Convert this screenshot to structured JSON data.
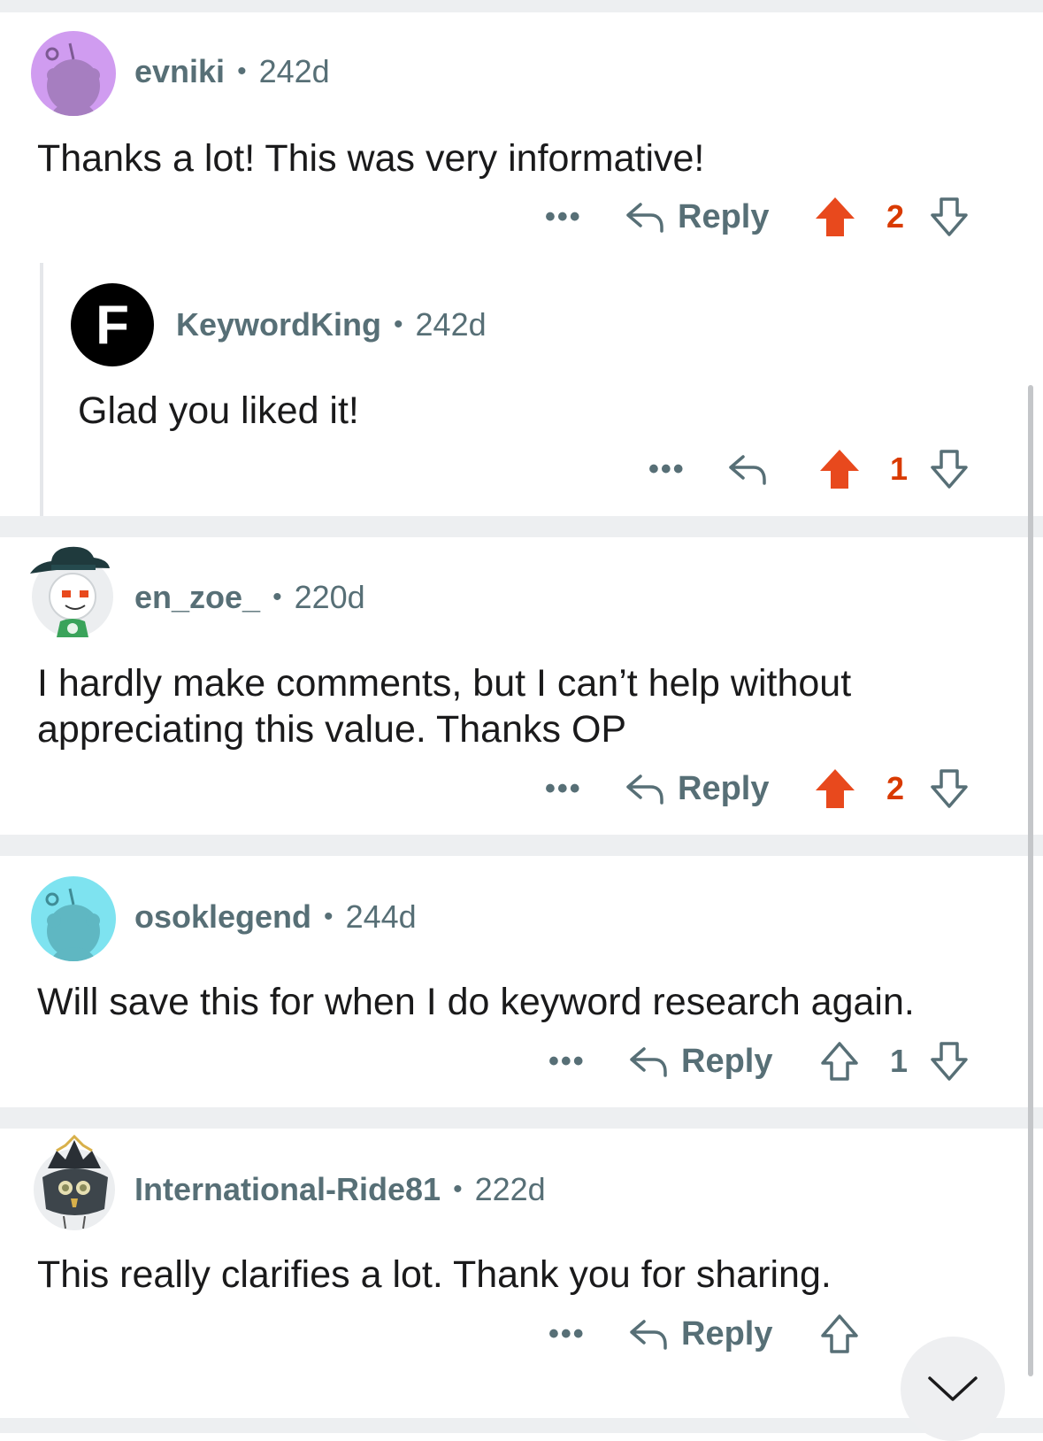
{
  "colors": {
    "upvote_active": "#d93a00",
    "meta_text": "#576f76",
    "separator": "#edeff1",
    "text": "#1a1a1b"
  },
  "comments": [
    {
      "username": "evniki",
      "age": "242d",
      "body": "Thanks a lot! This was very informative!",
      "reply_label": "Reply",
      "score": "2",
      "upvoted": true,
      "avatar_color": "#d09cf0",
      "avatar_icon": "snoo-default-icon"
    },
    {
      "username": "KeywordKing",
      "age": "242d",
      "body": "Glad you liked it!",
      "reply_label": "",
      "score": "1",
      "upvoted": true,
      "avatar_letter": "F",
      "avatar_color": "#000000",
      "is_nested": true
    },
    {
      "username": "en_zoe_",
      "age": "220d",
      "body_lines": [
        "I hardly make comments, but I can’t help without",
        "appreciating this value. Thanks OP"
      ],
      "reply_label": "Reply",
      "score": "2",
      "upvoted": true,
      "avatar_icon": "snoo-hat-avatar-icon"
    },
    {
      "username": "osoklegend",
      "age": "244d",
      "body": "Will save this for when I do keyword research again.",
      "reply_label": "Reply",
      "score": "1",
      "upvoted": false,
      "avatar_color": "#7ee3f0",
      "avatar_icon": "snoo-default-icon"
    },
    {
      "username": "International-Ride81",
      "age": "222d",
      "body": "This really clarifies a lot. Thank you for sharing.",
      "reply_label": "Reply",
      "score": "",
      "upvoted": false,
      "avatar_icon": "snoo-armor-avatar-icon"
    }
  ],
  "more_label": "•••",
  "separator_dot": "•"
}
